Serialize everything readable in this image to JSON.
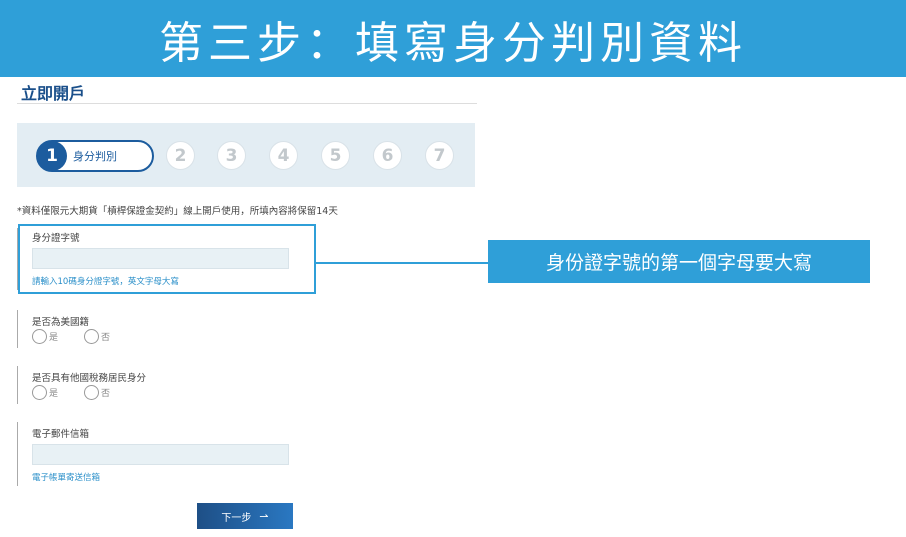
{
  "banner": {
    "title": "第三步：填寫身分判別資料"
  },
  "page": {
    "title": "立即開戶"
  },
  "stepper": {
    "active": {
      "number": "1",
      "label": "身分判別"
    },
    "steps": [
      "2",
      "3",
      "4",
      "5",
      "6",
      "7"
    ]
  },
  "notice": "*資料僅限元大期貨「槓桿保證金契約」線上開戶使用，所填內容將保留14天",
  "form": {
    "id_number": {
      "label": "身分證字號",
      "value": "",
      "hint": "請輸入10碼身分證字號，英文字母大寫"
    },
    "us_citizen": {
      "label": "是否為美國籍",
      "options": [
        "是",
        "否"
      ]
    },
    "foreign_tax": {
      "label": "是否具有他國稅務居民身分",
      "options": [
        "是",
        "否"
      ]
    },
    "email": {
      "label": "電子郵件信箱",
      "value": "",
      "hint": "電子帳單寄送信箱"
    }
  },
  "callout": "身份證字號的第一個字母要大寫",
  "next_button": {
    "label": "下一步",
    "icon": "arrow-right-icon"
  },
  "colors": {
    "accent": "#2f9fd8",
    "primary": "#1c5c9e"
  }
}
